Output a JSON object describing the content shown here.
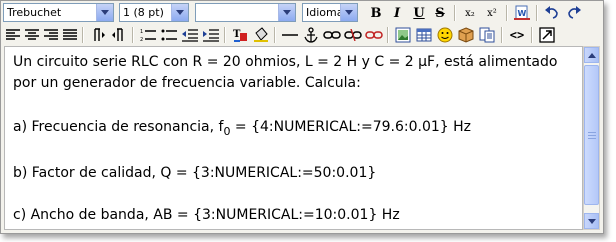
{
  "toolbar1": {
    "font_family": "Trebuchet",
    "font_size": "1 (8 pt)",
    "heading": "",
    "language": "Idioma",
    "bold": "B",
    "italic": "I",
    "underline": "U",
    "strike": "S",
    "subscript": "x₂",
    "superscript": "x²"
  },
  "toolbar2": {
    "html_source": "<>"
  },
  "content": {
    "line1": "Un circuito serie RLC con R = 20 ohmios, L = 2 H y C = 2 μF, está alimentado",
    "line2": "por un generador de frecuencia variable. Calcula:",
    "item_a_prefix": "a) Frecuencia de resonancia, f",
    "item_a_sub": "0",
    "item_a_suffix": " = {4:NUMERICAL:=79.6:0.01} Hz",
    "item_b": "b) Factor de calidad, Q = {3:NUMERICAL:=50:0.01}",
    "item_c": "c) Ancho de banda, AB = {3:NUMERICAL:=10:0.01} Hz"
  }
}
